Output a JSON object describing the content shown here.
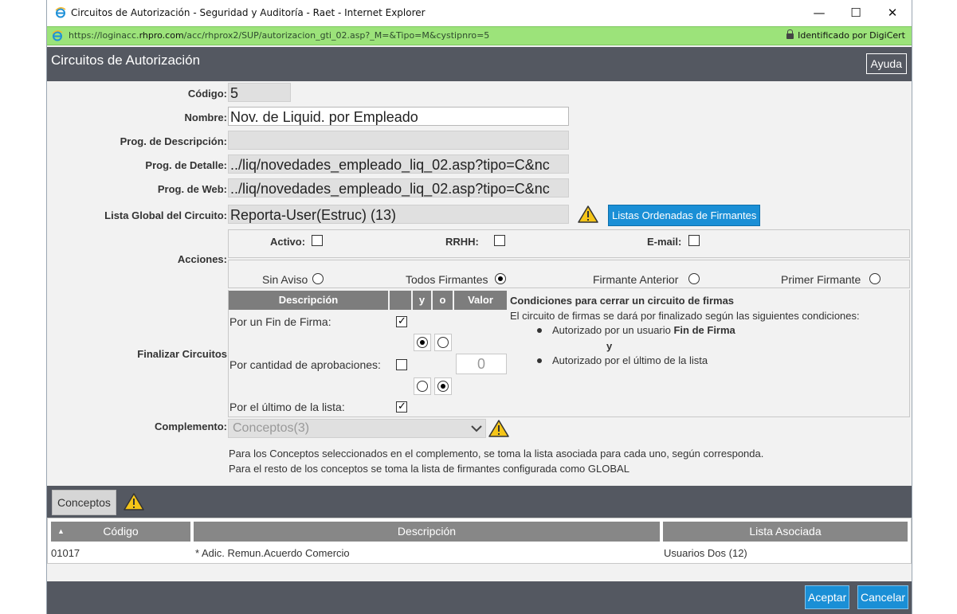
{
  "window": {
    "title": "Circuitos de Autorización - Seguridad y Auditoría - Raet - Internet Explorer",
    "minimize": "—",
    "maximize": "☐",
    "close": "✕"
  },
  "address": {
    "url_prefix": "https://loginacc.",
    "url_domain": "rhpro.com",
    "url_path": "/acc/rhprox2/SUP/autorizacion_gti_02.asp?_M=&Tipo=M&cystipnro=5",
    "cert": "Identificado por DigiCert"
  },
  "header": {
    "title": "Circuitos de Autorización",
    "help_label": "Ayuda"
  },
  "form": {
    "codigo_label": "Código:",
    "codigo_value": "5",
    "nombre_label": "Nombre:",
    "nombre_value": "Nov. de Liquid. por Empleado",
    "prog_desc_label": "Prog. de Descripción:",
    "prog_desc_value": "",
    "prog_detalle_label": "Prog. de Detalle:",
    "prog_detalle_value": "../liq/novedades_empleado_liq_02.asp?tipo=C&nc",
    "prog_web_label": "Prog. de Web:",
    "prog_web_value": "../liq/novedades_empleado_liq_02.asp?tipo=C&nc",
    "lista_global_label": "Lista Global del Circuito:",
    "lista_global_value": "Reporta-User(Estruc) (13)",
    "listas_button": "Listas Ordenadas de Firmantes"
  },
  "acciones": {
    "label": "Acciones:",
    "activo": "Activo:",
    "rrhh": "RRHH:",
    "email": "E-mail:",
    "sin_aviso": "Sin Aviso",
    "todos_firmantes": "Todos Firmantes",
    "firmante_anterior": "Firmante Anterior",
    "primer_firmante": "Primer Firmante"
  },
  "finalizar": {
    "label": "Finalizar Circuitos",
    "headers": {
      "descripcion": "Descripción",
      "y": "y",
      "o": "o",
      "valor": "Valor"
    },
    "row1": "Por un Fin de Firma:",
    "row2": "Por cantidad de aprobaciones:",
    "row2_value": "0",
    "row3": "Por el último de la lista:",
    "cond_title": "Condiciones para cerrar un circuito de firmas",
    "cond_intro": "El circuito de firmas se dará por finalizado según las siguientes condiciones:",
    "cond_1_pre": "Autorizado por un usuario ",
    "cond_1_bold": "Fin de Firma",
    "cond_y": "y",
    "cond_2": "Autorizado por el último de la lista"
  },
  "complemento": {
    "label": "Complemento:",
    "selected": "Conceptos(3)",
    "note1": "Para los Conceptos seleccionados en el complemento, se toma la lista asociada para cada uno, según corresponda.",
    "note2": "Para el resto de los conceptos se toma la lista de firmantes configurada como GLOBAL"
  },
  "conceptos": {
    "tab_label": "Conceptos",
    "sort_indicator": "▲",
    "columns": [
      "Código",
      "Descripción",
      "Lista Asociada"
    ],
    "rows": [
      {
        "codigo": "01017",
        "descripcion": "* Adic. Remun.Acuerdo Comercio",
        "lista": "Usuarios Dos (12)"
      }
    ]
  },
  "footer": {
    "accept": "Aceptar",
    "cancel": "Cancelar"
  },
  "colors": {
    "header_bg": "#545861",
    "accent_blue": "#1a8fd6",
    "address_green": "#9ce37a"
  }
}
